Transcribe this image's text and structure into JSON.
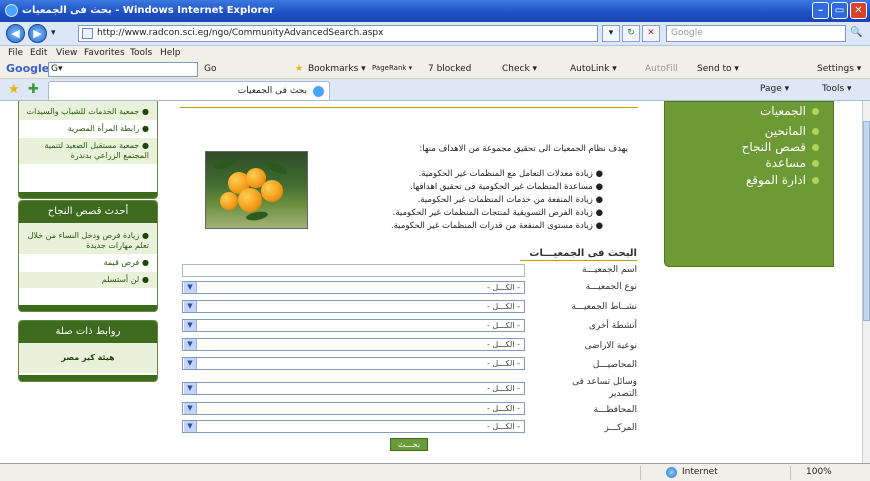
{
  "window": {
    "title": "بحث فى الجمعيات - Windows Internet Explorer",
    "min_symbol": "–",
    "max_symbol": "▭",
    "close_symbol": "✕"
  },
  "address": {
    "back_symbol": "◀",
    "fwd_symbol": "▶",
    "dropdown_symbol": "▾",
    "url": "http://www.radcon.sci.eg/ngo/CommunityAdvancedSearch.aspx",
    "refresh_symbol": "↻",
    "stop_symbol": "✕",
    "search_placeholder": "Google",
    "search_go": "🔍"
  },
  "menu": {
    "items": [
      "File",
      "Edit",
      "View",
      "Favorites",
      "Tools",
      "Help"
    ]
  },
  "google_toolbar": {
    "logo": "Google",
    "field_value": "G▾",
    "go": "Go",
    "bookmarks": "Bookmarks ▾",
    "pagerank": "PageRank ▾",
    "blocked": "7 blocked",
    "check": "Check ▾",
    "autolink": "AutoLink ▾",
    "autofill": "AutoFill",
    "sendto": "Send to ▾",
    "settings": "Settings ▾"
  },
  "tabs": {
    "active_label": "بحث فى الجمعيات",
    "page_menu": "Page ▾",
    "tools_menu": "Tools ▾"
  },
  "left_sidebar": {
    "box1_items": [
      "جمعية الخدمات للشباب والسيدات",
      "رابطة المرأة المصرية",
      "جمعية مستقبل الصعيد لتنمية المجتمع الزراعي بدندرة"
    ],
    "box2_title": "أحدث قصص النجاح",
    "box2_items": [
      "زيادة فرص ودخل النساء من خلال تعلم مهارات جديدة",
      "فرص قيمة",
      "لن أستسلم"
    ],
    "box3_title": "روابط ذات صلة",
    "box3_items": [
      "هيئة كير مصر"
    ]
  },
  "main": {
    "intro": "يهدف نظام الجمعيات الى تحقيق مجموعة من الاهداف منها:",
    "goals": [
      "زيادة معدلات التعامل مع المنظمات غير الحكومية.",
      "مساعدة المنظمات غير الحكومية فى تحقيق اهدافها.",
      "زيادة المنفعة من خدمات المنظمات غير الحكومية.",
      "زيادة الفرص التسويقية لمنتجات المنظمات غير الحكومية.",
      "زيادة مستوى المنفعة من قدرات المنظمات غير الحكومية."
    ],
    "search_title": "البحث فى الجمعيـــات",
    "fields": {
      "name_label": "اسم الجمعيـــة",
      "type_label": "نوع الجمعيـــة",
      "activity_label": "نشــاط الجمعيـــة",
      "other_label": "أنشطة أخرى",
      "land_label": "نوعية الاراضى",
      "crops_label": "المحاصيـــل",
      "export_label": "وسائل تساعد فى التصدير",
      "gov_label": "المحافظـــة",
      "center_label": "المركـــز",
      "all_option": "- الكـــل -"
    },
    "search_button": "بحـــث"
  },
  "right_nav": {
    "items": [
      "الجمعيات",
      "المانحين",
      "قصص النجاح",
      "مساعدة",
      "ادارة الموقع"
    ]
  },
  "status": {
    "zone": "Internet",
    "zoom": "100%"
  }
}
